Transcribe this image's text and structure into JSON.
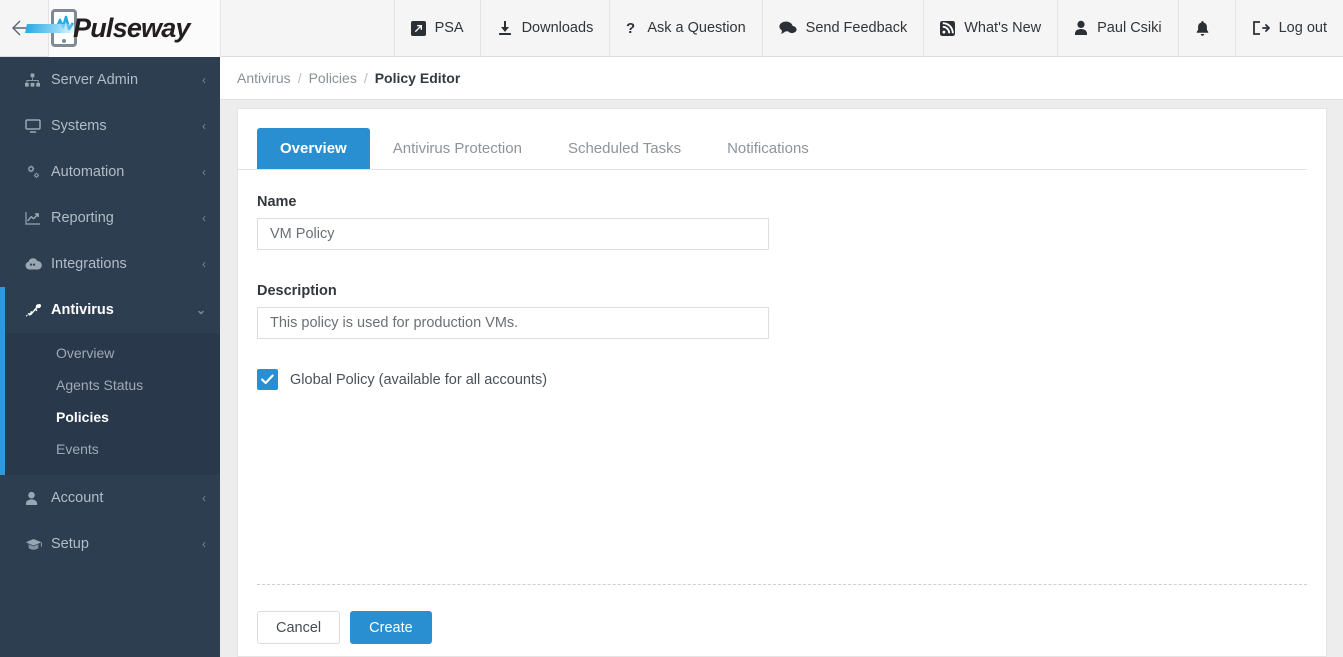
{
  "topbar": {
    "back_icon": "arrow-left-icon",
    "logo_text": "Pulseway",
    "nav_items": [
      {
        "label": "PSA",
        "icon": "external-link-icon"
      },
      {
        "label": "Downloads",
        "icon": "download-icon"
      },
      {
        "label": "Ask a Question",
        "icon": "question-mark-icon"
      },
      {
        "label": "Send Feedback",
        "icon": "comment-icon"
      },
      {
        "label": "What's New",
        "icon": "rss-icon"
      },
      {
        "label": "Paul Csiki",
        "icon": "user-icon"
      },
      {
        "label": "",
        "icon": "bell-icon"
      },
      {
        "label": "Log out",
        "icon": "logout-icon"
      }
    ]
  },
  "sidebar": {
    "items": [
      {
        "label": "Server Admin",
        "icon": "sitemap-icon",
        "chevron": "‹",
        "active": false
      },
      {
        "label": "Systems",
        "icon": "monitor-icon",
        "chevron": "‹",
        "active": false
      },
      {
        "label": "Automation",
        "icon": "gears-icon",
        "chevron": "‹",
        "active": false
      },
      {
        "label": "Reporting",
        "icon": "chart-line-icon",
        "chevron": "‹",
        "active": false
      },
      {
        "label": "Integrations",
        "icon": "cloud-icon",
        "chevron": "‹",
        "active": false
      },
      {
        "label": "Antivirus",
        "icon": "shield-virus-icon",
        "chevron": "⌄",
        "active": true
      }
    ],
    "submenu": [
      {
        "label": "Overview",
        "current": false
      },
      {
        "label": "Agents Status",
        "current": false
      },
      {
        "label": "Policies",
        "current": true
      },
      {
        "label": "Events",
        "current": false
      }
    ],
    "items_after": [
      {
        "label": "Account",
        "icon": "user-icon",
        "chevron": "‹",
        "active": false
      },
      {
        "label": "Setup",
        "icon": "graduation-cap-icon",
        "chevron": "‹",
        "active": false
      }
    ]
  },
  "breadcrumb": {
    "root": "Antivirus",
    "parent": "Policies",
    "current": "Policy Editor",
    "separator": "/"
  },
  "editor": {
    "tabs": [
      {
        "label": "Overview",
        "active": true
      },
      {
        "label": "Antivirus Protection",
        "active": false
      },
      {
        "label": "Scheduled Tasks",
        "active": false
      },
      {
        "label": "Notifications",
        "active": false
      }
    ],
    "name_label": "Name",
    "name_value": "VM Policy",
    "name_placeholder": "Name",
    "description_label": "Description",
    "description_value": "This policy is used for production VMs.",
    "description_placeholder": "Description",
    "global_policy_label": "Global Policy (available for all accounts)",
    "global_policy_checked": true,
    "cancel_label": "Cancel",
    "create_label": "Create"
  },
  "colors": {
    "accent_blue": "#2a8fd0",
    "sidebar_bg": "#2d3e50",
    "submenu_bg": "#29384a",
    "page_bg": "#ededed"
  }
}
